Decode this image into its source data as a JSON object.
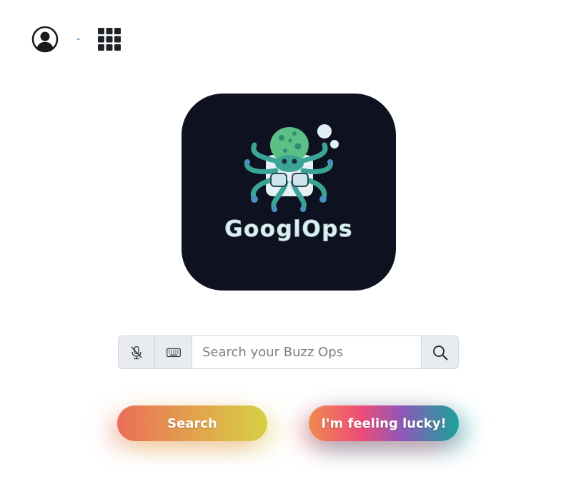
{
  "header": {
    "account_icon": "user-circle-icon",
    "username": "-",
    "apps_icon": "apps-grid-icon"
  },
  "logo": {
    "text": "GooglOps",
    "background_color": "#0e1120",
    "mascot": "octopus"
  },
  "search": {
    "mic_icon": "microphone-muted-icon",
    "keyboard_icon": "keyboard-icon",
    "placeholder": "Search your Buzz Ops",
    "value": "",
    "submit_icon": "search-icon"
  },
  "buttons": {
    "search_label": "Search",
    "lucky_label": "I'm feeling lucky!"
  },
  "colors": {
    "link": "#1a6fbf",
    "addon_bg": "#e9ecef",
    "border": "#ced4da"
  }
}
